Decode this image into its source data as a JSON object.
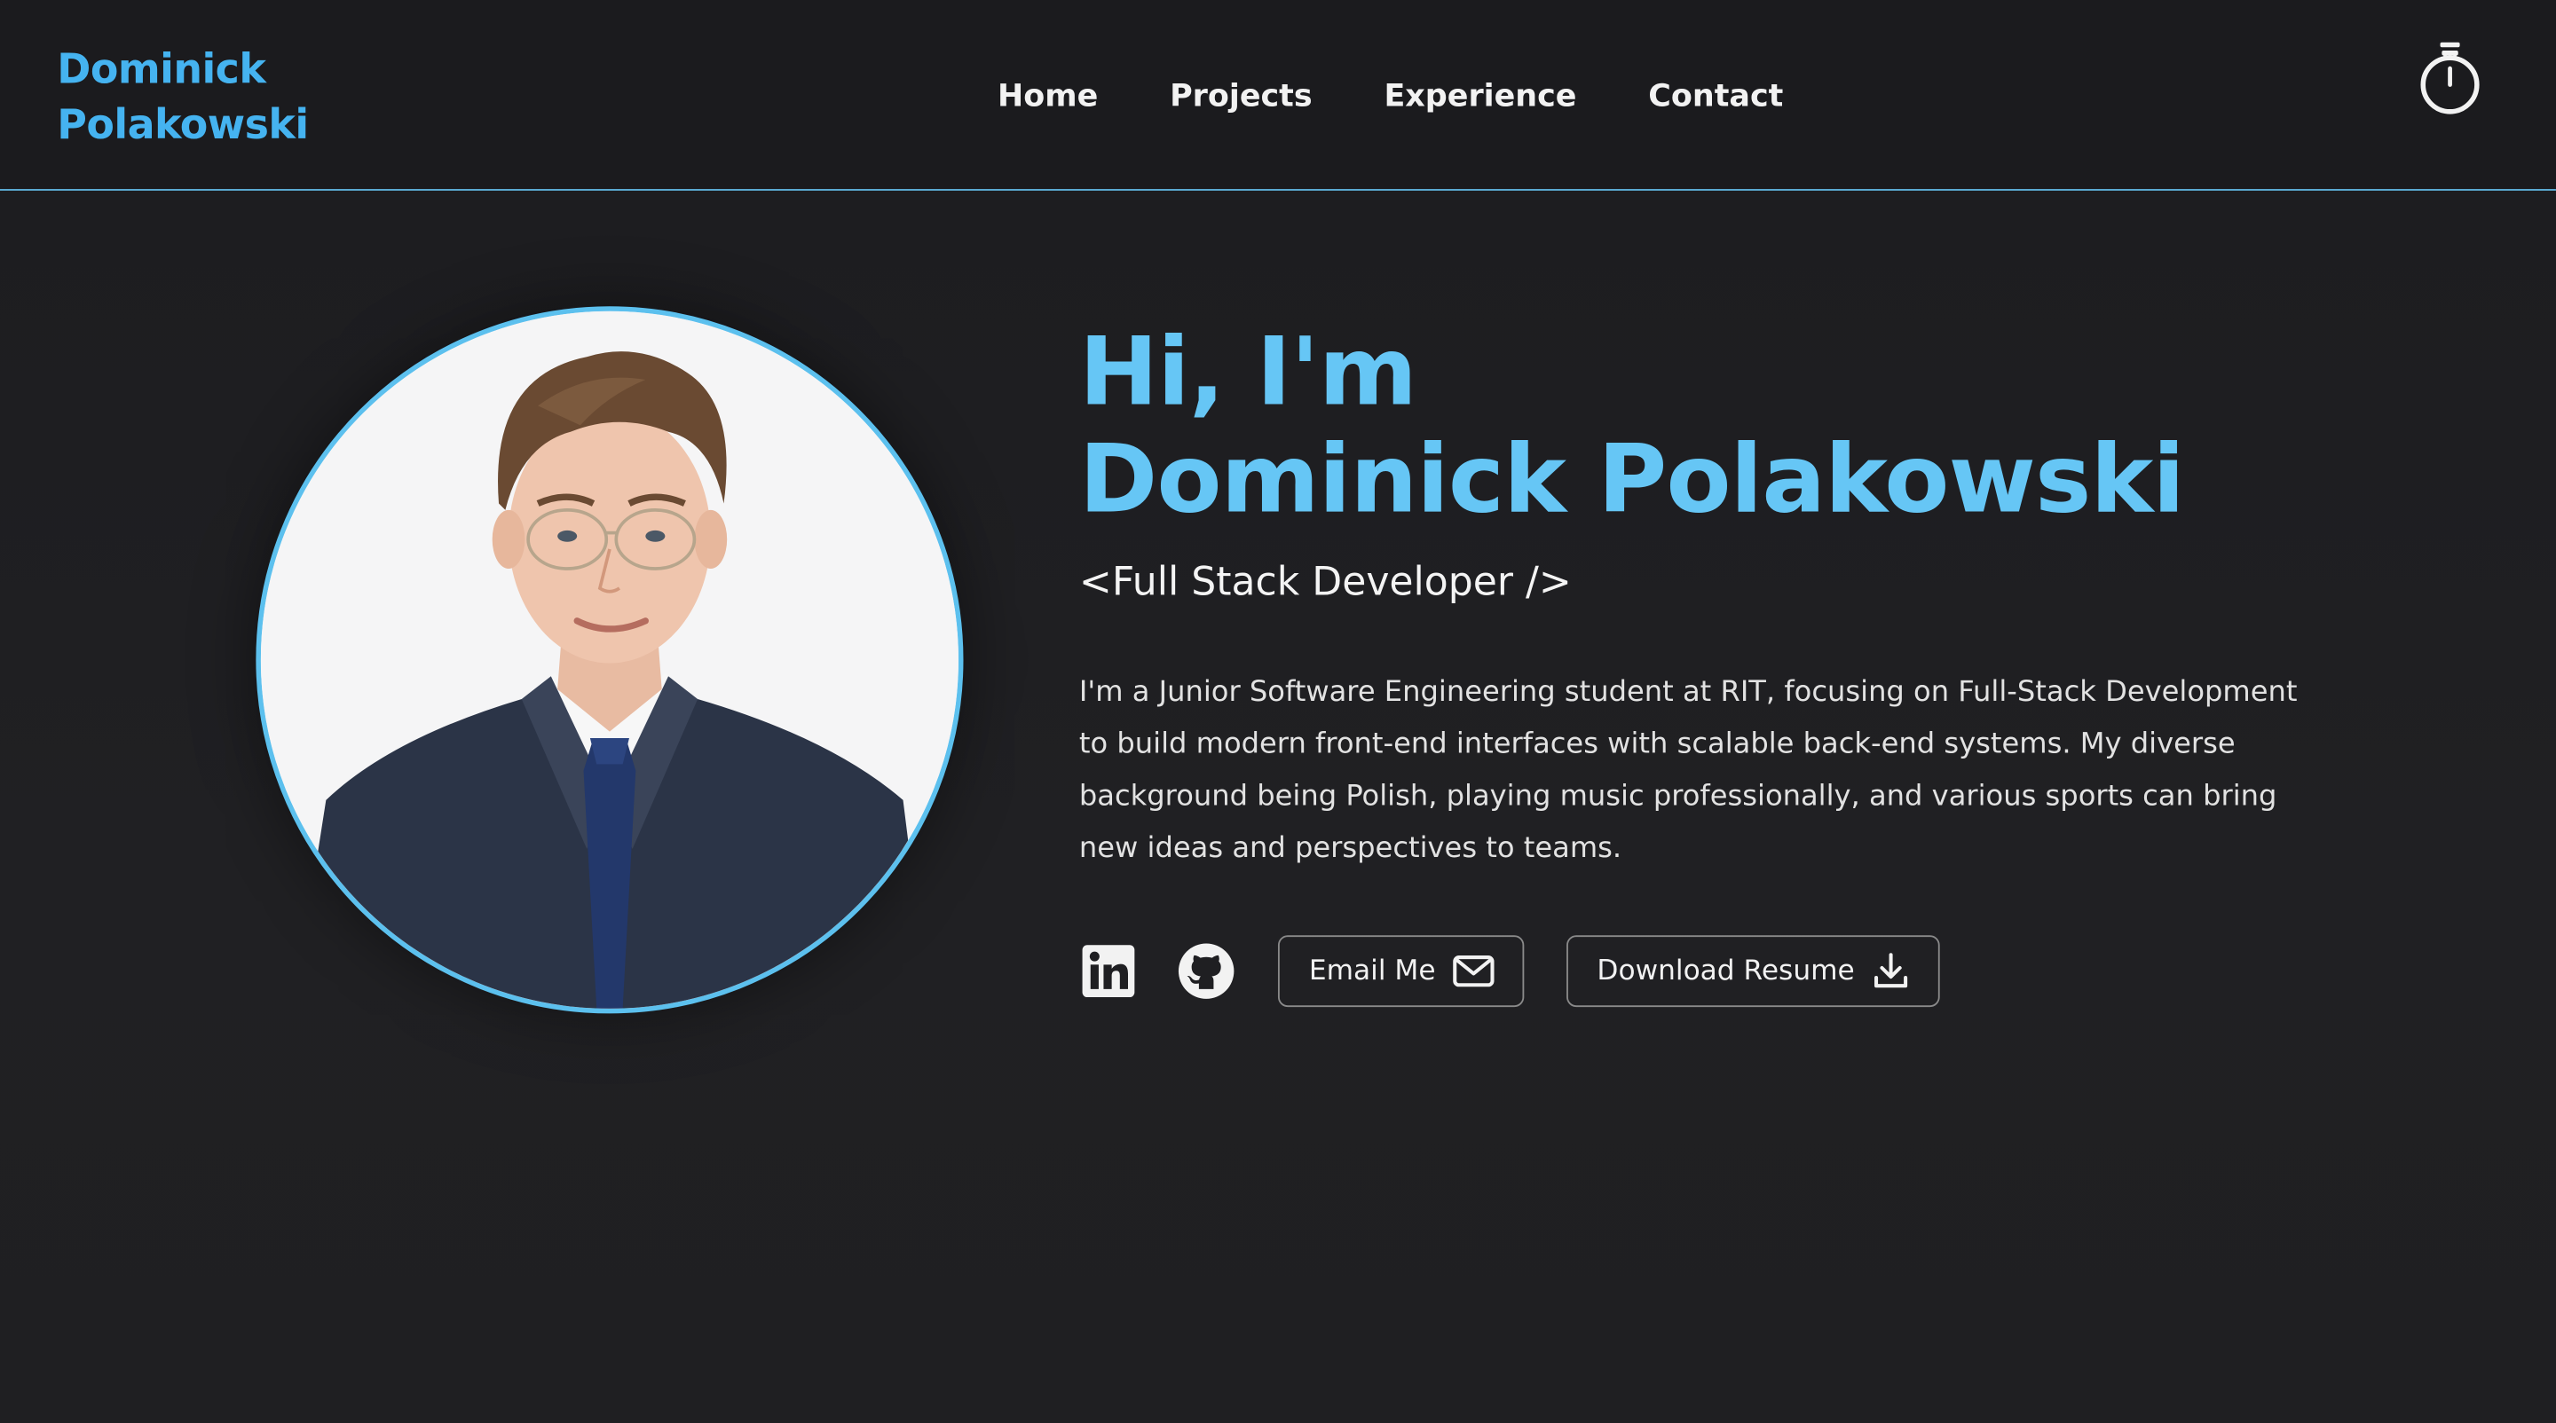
{
  "header": {
    "brand_line1": "Dominick",
    "brand_line2": "Polakowski",
    "nav": {
      "home": "Home",
      "projects": "Projects",
      "experience": "Experience",
      "contact": "Contact"
    },
    "theme_toggle_icon": "lightbulb-icon"
  },
  "hero": {
    "greeting_line1": "Hi, I'm",
    "greeting_line2": "Dominick Polakowski",
    "role": "<Full Stack Developer />",
    "bio": "I'm a Junior Software Engineering student at RIT, focusing on Full-Stack Development to build modern front-end interfaces with scalable back-end systems. My diverse background being Polish, playing music professionally, and various sports can bring new ideas and perspectives to teams.",
    "social": {
      "linkedin_icon": "linkedin-icon",
      "github_icon": "github-icon"
    },
    "buttons": {
      "email_label": "Email Me",
      "email_icon": "mail-icon",
      "resume_label": "Download Resume",
      "resume_icon": "download-icon"
    }
  },
  "colors": {
    "accent": "#45b3f0",
    "heading": "#66c6f5",
    "background": "#1f1f22",
    "header_border": "#5fb4df"
  }
}
